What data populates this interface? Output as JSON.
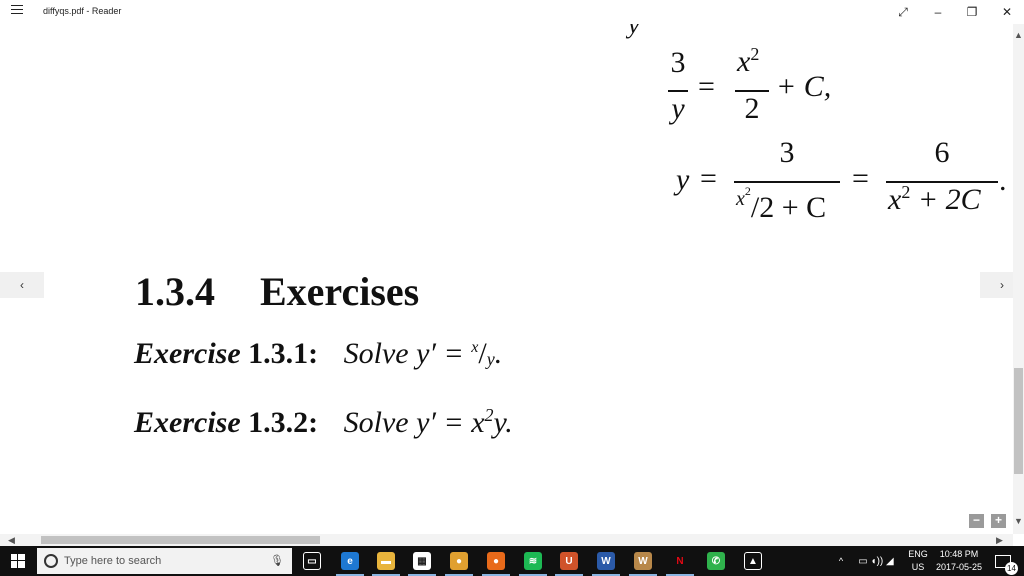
{
  "window": {
    "title": "diffyqs.pdf - Reader",
    "menu_icon": "hamburger-icon",
    "controls": [
      "⤢",
      "–",
      "❐",
      "✕"
    ]
  },
  "document": {
    "equation_top": {
      "partial_y": "y",
      "lhs_num": "3",
      "lhs_den": "y",
      "equals": "=",
      "rhs_num_base": "x",
      "rhs_num_exp": "2",
      "rhs_den": "2",
      "rhs_tail": "+ C,"
    },
    "equation_bottom": {
      "lhs": "y",
      "equals": "=",
      "f1_num": "3",
      "f1_den_base": "x",
      "f1_den_exp": "2",
      "f1_den_tail": "/2 + C",
      "equals2": "=",
      "f2_num": "6",
      "f2_den_base": "x",
      "f2_den_exp": "2",
      "f2_den_tail": " + 2C",
      "period": "."
    },
    "section": {
      "number": "1.3.4",
      "title": "Exercises"
    },
    "exercises": [
      {
        "label": "Exercise",
        "number": "1.3.1:",
        "prefix": "Solve y′ = ",
        "x": "x",
        "slash": "/",
        "y": "y",
        "suffix": "."
      },
      {
        "label": "Exercise",
        "number": "1.3.2:",
        "prefix": "Solve y′ = x",
        "exp": "2",
        "suffix": "y."
      }
    ]
  },
  "navigation": {
    "prev_page": "‹",
    "next_page": "›"
  },
  "zoom": {
    "out": "−",
    "in": "+"
  },
  "taskbar": {
    "search_placeholder": "Type here to search",
    "apps": [
      {
        "name": "task-view-icon",
        "glyph": "▭",
        "color": "#101010"
      },
      {
        "name": "edge-icon",
        "glyph": "e",
        "color": "#1e78d2"
      },
      {
        "name": "file-explorer-icon",
        "glyph": "▬",
        "color": "#e8b43c"
      },
      {
        "name": "store-icon",
        "glyph": "▦",
        "color": "#ffffff"
      },
      {
        "name": "chrome-icon",
        "glyph": "●",
        "color": "#e0a030"
      },
      {
        "name": "firefox-icon",
        "glyph": "●",
        "color": "#e86a1a"
      },
      {
        "name": "spotify-icon",
        "glyph": "≋",
        "color": "#1db954"
      },
      {
        "name": "reader-icon",
        "glyph": "U",
        "color": "#d0532a"
      },
      {
        "name": "word-icon",
        "glyph": "W",
        "color": "#2b5aa8"
      },
      {
        "name": "word-alt-icon",
        "glyph": "W",
        "color": "#b8884a"
      },
      {
        "name": "netflix-icon",
        "glyph": "N",
        "color": "#101010"
      },
      {
        "name": "whatsapp-icon",
        "glyph": "✆",
        "color": "#2fb24c"
      },
      {
        "name": "photos-icon",
        "glyph": "▲",
        "color": "#101010"
      }
    ],
    "tray": {
      "chevron": "^",
      "lang_top": "ENG",
      "lang_bottom": "US",
      "time": "10:48 PM",
      "date": "2017-05-25",
      "notifications": "14"
    }
  }
}
